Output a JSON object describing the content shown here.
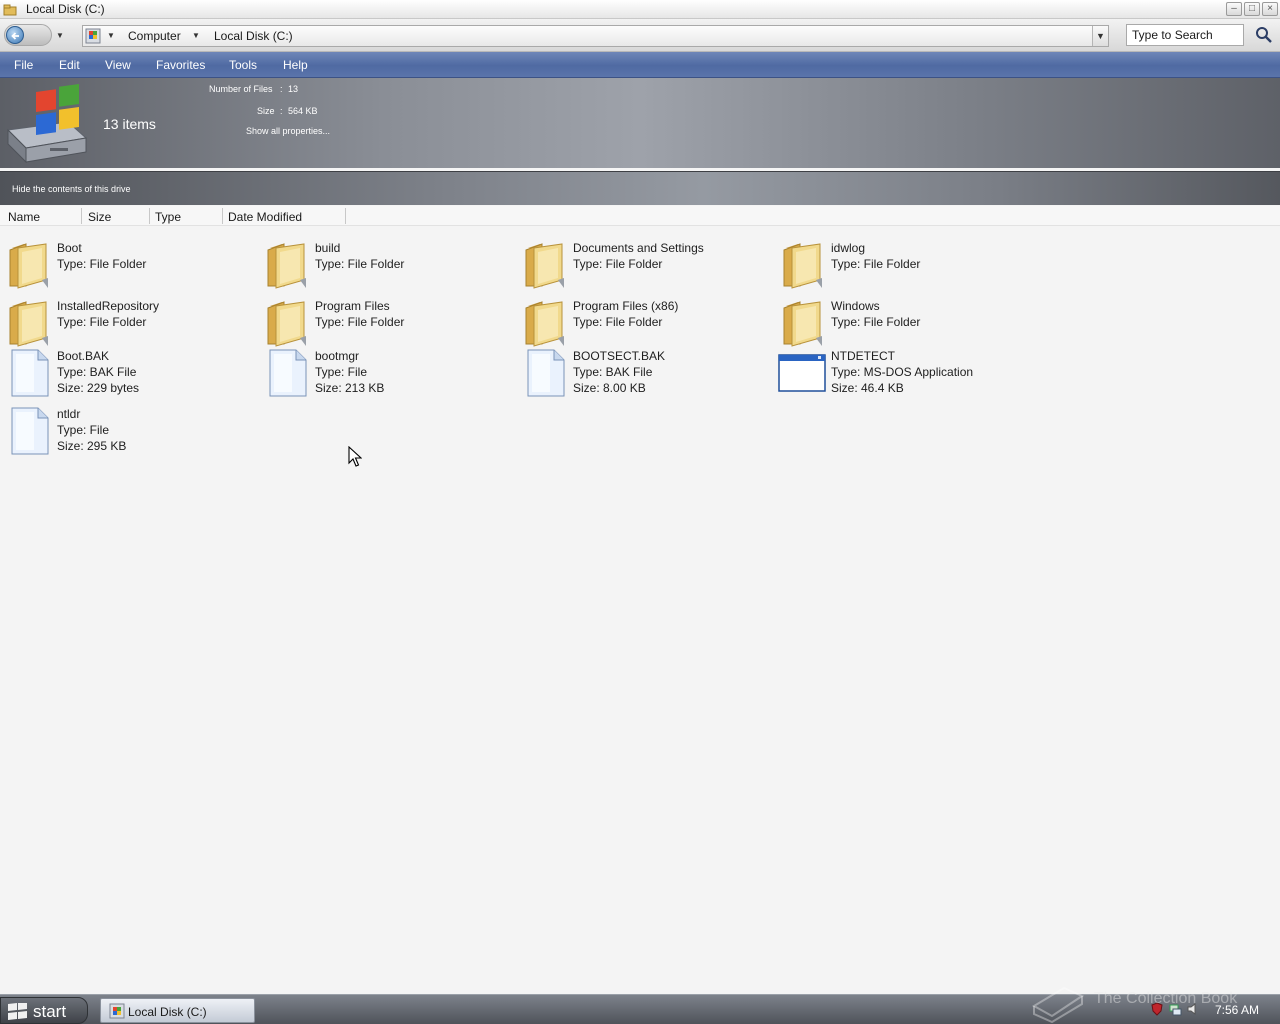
{
  "window": {
    "title": "Local Disk (C:)"
  },
  "title_buttons": [
    "minimize",
    "maximize",
    "close"
  ],
  "address": {
    "crumbs": [
      "Computer",
      "Local Disk (C:)"
    ],
    "search_placeholder": "Type to Search"
  },
  "menu": [
    "File",
    "Edit",
    "View",
    "Favorites",
    "Tools",
    "Help"
  ],
  "info": {
    "items_count": "13 items",
    "number_of_files_label": "Number of Files",
    "number_of_files_value": "13",
    "size_label": "Size",
    "size_value": "564 KB",
    "separator": ":",
    "show_all": "Show all properties..."
  },
  "tasks": {
    "hide_contents": "Hide the contents of this drive"
  },
  "columns": [
    "Name",
    "Size",
    "Type",
    "Date Modified"
  ],
  "files": [
    {
      "name": "Boot",
      "type": "Type: File Folder",
      "size": "",
      "icon": "folder-icon"
    },
    {
      "name": "build",
      "type": "Type: File Folder",
      "size": "",
      "icon": "folder-icon"
    },
    {
      "name": "Documents and Settings",
      "type": "Type: File Folder",
      "size": "",
      "icon": "folder-icon"
    },
    {
      "name": "idwlog",
      "type": "Type: File Folder",
      "size": "",
      "icon": "folder-icon"
    },
    {
      "name": "InstalledRepository",
      "type": "Type: File Folder",
      "size": "",
      "icon": "folder-icon"
    },
    {
      "name": "Program Files",
      "type": "Type: File Folder",
      "size": "",
      "icon": "folder-icon"
    },
    {
      "name": "Program Files (x86)",
      "type": "Type: File Folder",
      "size": "",
      "icon": "folder-icon"
    },
    {
      "name": "Windows",
      "type": "Type: File Folder",
      "size": "",
      "icon": "folder-icon"
    },
    {
      "name": "Boot.BAK",
      "type": "Type: BAK File",
      "size": "Size: 229 bytes",
      "icon": "file-icon"
    },
    {
      "name": "bootmgr",
      "type": "Type: File",
      "size": "Size: 213 KB",
      "icon": "file-icon"
    },
    {
      "name": "BOOTSECT.BAK",
      "type": "Type: BAK File",
      "size": "Size: 8.00 KB",
      "icon": "file-icon"
    },
    {
      "name": "NTDETECT",
      "type": "Type: MS-DOS Application",
      "size": "Size: 46.4 KB",
      "icon": "application-window-icon"
    },
    {
      "name": "ntldr",
      "type": "Type: File",
      "size": "Size: 295 KB",
      "icon": "file-icon"
    }
  ],
  "taskbar": {
    "start_label": "start",
    "task_label": "Local Disk (C:)",
    "clock": "7:56 AM",
    "watermark": "The Collection Book"
  },
  "colors": {
    "menubar": "#4f6aa2",
    "panel": "#8a8e96",
    "background": "#f4f4f4",
    "folder": "#e8c76a"
  }
}
